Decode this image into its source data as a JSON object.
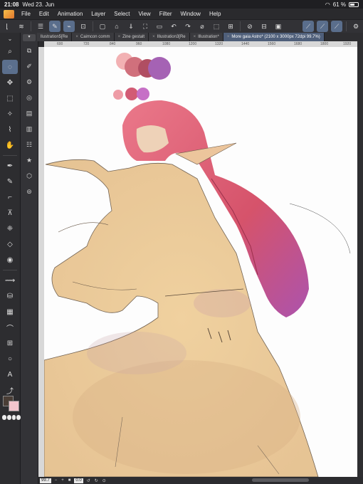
{
  "status": {
    "time": "21:08",
    "date": "Wed 23. Jun",
    "battery": "61 %",
    "battery_level": 0.61
  },
  "menu": {
    "items": [
      "File",
      "Edit",
      "Animation",
      "Layer",
      "Select",
      "View",
      "Filter",
      "Window",
      "Help"
    ]
  },
  "tabs": [
    {
      "label": "llustration5[Re"
    },
    {
      "label": "Caimcon comm"
    },
    {
      "label": "Zine gestalt"
    },
    {
      "label": "Illustration3[Re"
    },
    {
      "label": "Illustration*"
    },
    {
      "label": "More gaia Astro* (2100 x 3000px 72dpi 99.7%)",
      "active": true
    }
  ],
  "ruler": {
    "ticks": [
      "600",
      "720",
      "840",
      "960",
      "1080",
      "1200",
      "1320",
      "1440",
      "1560",
      "1680",
      "1800",
      "1920"
    ]
  },
  "bottombar": {
    "zoom": "99.7",
    "angle": "0.0"
  },
  "colors": {
    "main": "#4a3e36",
    "sub": "#f2c5cc",
    "accent": "#5b6f8d"
  },
  "palette_swatches": [
    "#f2b1b3",
    "#d0707c",
    "#b04e62",
    "#a562b4",
    "#ee9ca6",
    "#d25b74",
    "#c670c6"
  ]
}
